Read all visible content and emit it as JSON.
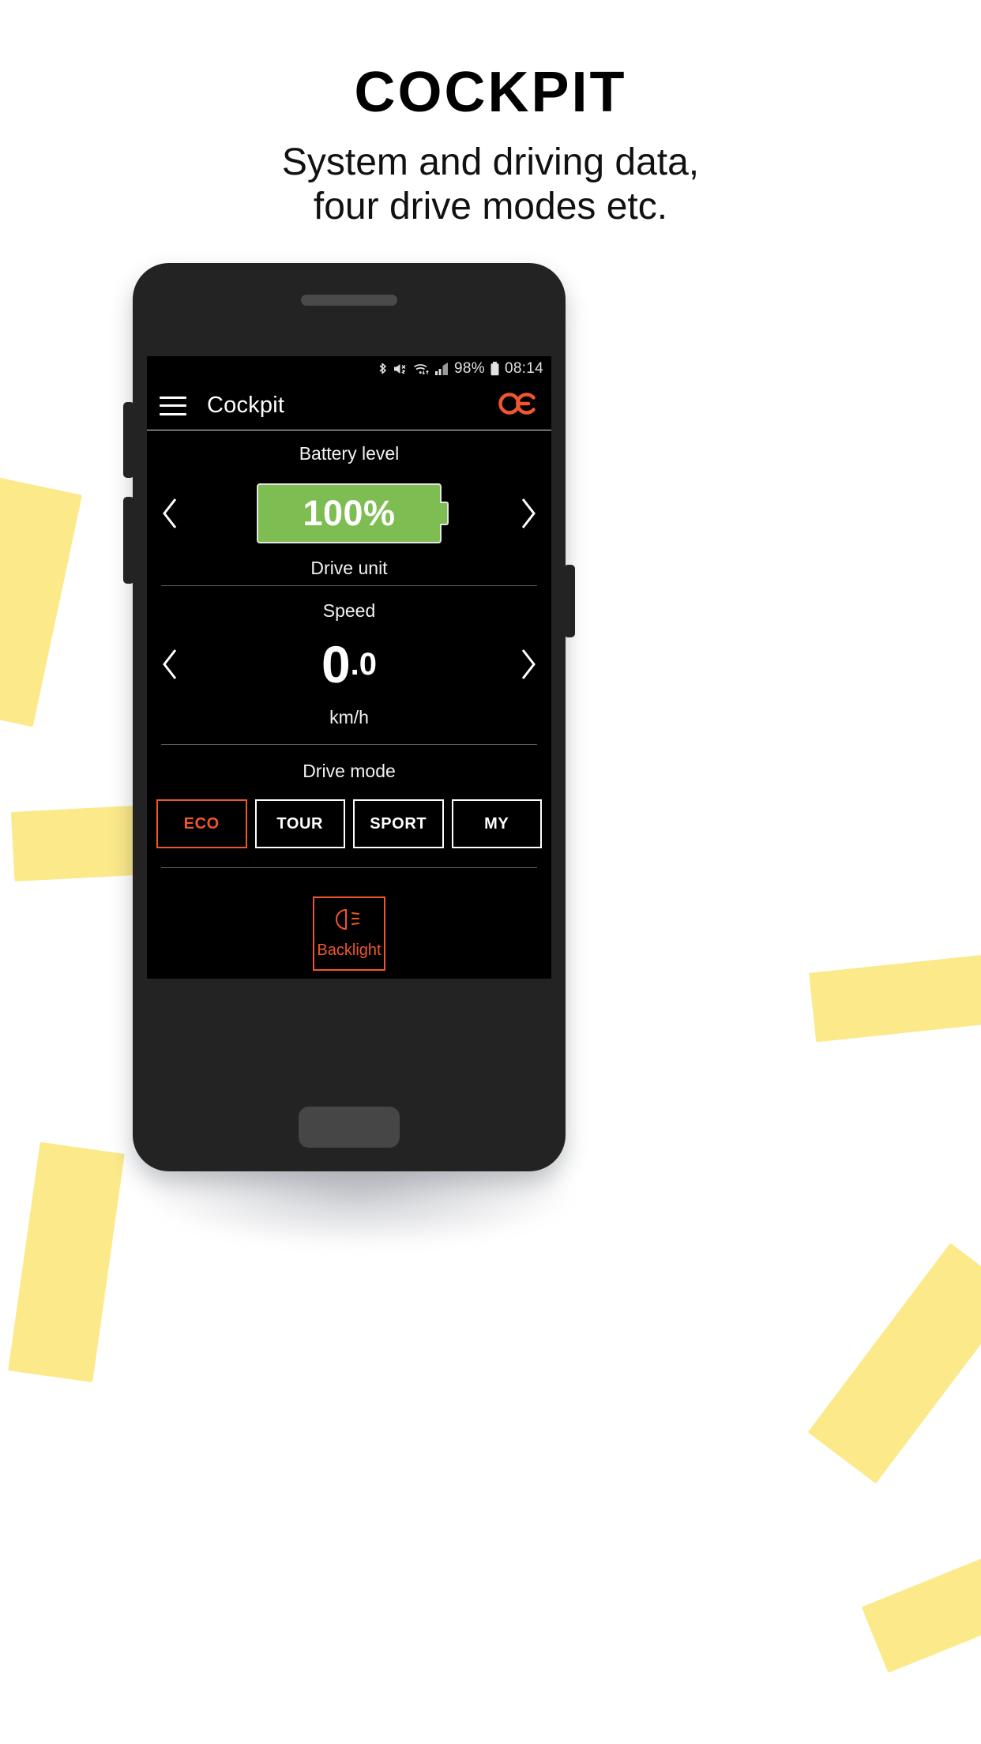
{
  "page": {
    "title": "COCKPIT",
    "subtitle_line1": "System and driving data,",
    "subtitle_line2": "four drive modes etc.",
    "background": "#ffffff",
    "accent_yellow": "#fbe98a"
  },
  "phone": {
    "body_color": "#232323",
    "speaker_name": "earpiece-speaker",
    "home_button_name": "home-button"
  },
  "statusbar": {
    "bluetooth_icon": "bluetooth-icon",
    "mute_icon": "volume-mute-icon",
    "wifi_icon": "wifi-icon",
    "signal_icon": "cellular-signal-icon",
    "battery_percent": "98%",
    "battery_icon": "battery-full-icon",
    "time": "08:14"
  },
  "appbar": {
    "menu_icon": "hamburger-menu-icon",
    "title": "Cockpit",
    "brand_icon": "cobi-rings-logo",
    "brand_color": "#f0562d"
  },
  "battery_section": {
    "label": "Battery level",
    "value": "100%",
    "sub_label": "Drive unit",
    "fill_color": "#7dbd52",
    "prev_icon": "chevron-left-icon",
    "next_icon": "chevron-right-icon"
  },
  "speed_section": {
    "label": "Speed",
    "value_integer": "0",
    "value_decimal": ".0",
    "unit": "km/h",
    "prev_icon": "chevron-left-icon",
    "next_icon": "chevron-right-icon"
  },
  "drive_mode_section": {
    "label": "Drive mode",
    "selected": "ECO",
    "modes": [
      {
        "label": "ECO",
        "active": true
      },
      {
        "label": "TOUR",
        "active": false
      },
      {
        "label": "SPORT",
        "active": false
      },
      {
        "label": "MY",
        "active": false
      }
    ]
  },
  "backlight_section": {
    "label": "Backlight",
    "icon": "headlight-icon",
    "color": "#f0562d"
  }
}
